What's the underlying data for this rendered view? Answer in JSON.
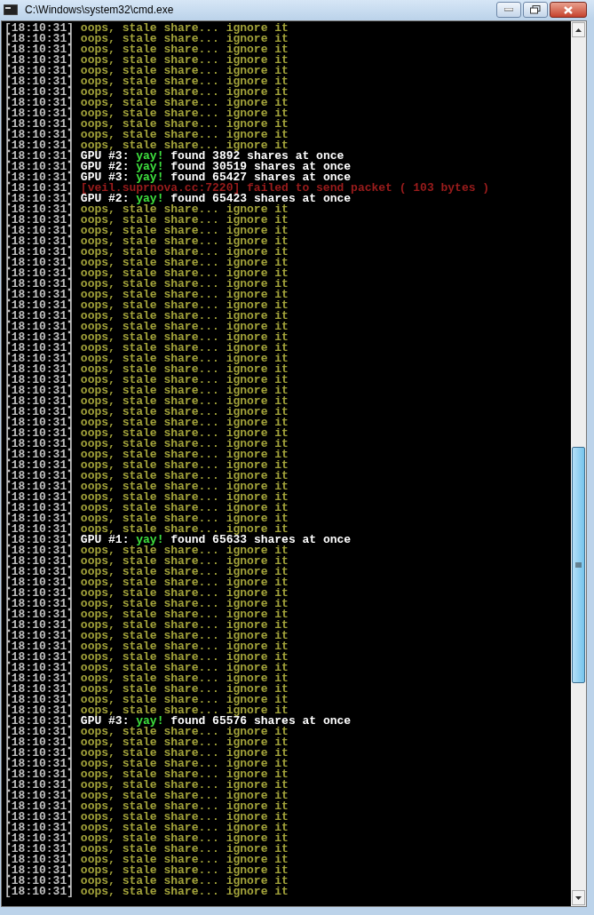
{
  "window": {
    "title": "C:\\Windows\\system32\\cmd.exe"
  },
  "lines": [
    {
      "kind": "stale",
      "time": "[18:10:31]",
      "text": "oops, stale share... ignore it"
    },
    {
      "kind": "stale",
      "time": "[18:10:31]",
      "text": "oops, stale share... ignore it"
    },
    {
      "kind": "stale",
      "time": "[18:10:31]",
      "text": "oops, stale share... ignore it"
    },
    {
      "kind": "stale",
      "time": "[18:10:31]",
      "text": "oops, stale share... ignore it"
    },
    {
      "kind": "stale",
      "time": "[18:10:31]",
      "text": "oops, stale share... ignore it"
    },
    {
      "kind": "stale",
      "time": "[18:10:31]",
      "text": "oops, stale share... ignore it"
    },
    {
      "kind": "stale",
      "time": "[18:10:31]",
      "text": "oops, stale share... ignore it"
    },
    {
      "kind": "stale",
      "time": "[18:10:31]",
      "text": "oops, stale share... ignore it"
    },
    {
      "kind": "stale",
      "time": "[18:10:31]",
      "text": "oops, stale share... ignore it"
    },
    {
      "kind": "stale",
      "time": "[18:10:31]",
      "text": "oops, stale share... ignore it"
    },
    {
      "kind": "stale",
      "time": "[18:10:31]",
      "text": "oops, stale share... ignore it"
    },
    {
      "kind": "stale",
      "time": "[18:10:31]",
      "text": "oops, stale share... ignore it"
    },
    {
      "kind": "found",
      "time": "[18:10:31]",
      "gpu": "GPU #3:",
      "yay": "yay!",
      "text": "found 3892 shares at once"
    },
    {
      "kind": "found",
      "time": "[18:10:31]",
      "gpu": "GPU #2:",
      "yay": "yay!",
      "text": "found 30519 shares at once"
    },
    {
      "kind": "found",
      "time": "[18:10:31]",
      "gpu": "GPU #3:",
      "yay": "yay!",
      "text": "found 65427 shares at once"
    },
    {
      "kind": "error",
      "time": "[18:10:31]",
      "text": "[veil.suprnova.cc:7220] failed to send packet ( 103 bytes )"
    },
    {
      "kind": "found",
      "time": "[18:10:31]",
      "gpu": "GPU #2:",
      "yay": "yay!",
      "text": "found 65423 shares at once"
    },
    {
      "kind": "stale",
      "time": "[18:10:31]",
      "text": "oops, stale share... ignore it"
    },
    {
      "kind": "stale",
      "time": "[18:10:31]",
      "text": "oops, stale share... ignore it"
    },
    {
      "kind": "stale",
      "time": "[18:10:31]",
      "text": "oops, stale share... ignore it"
    },
    {
      "kind": "stale",
      "time": "[18:10:31]",
      "text": "oops, stale share... ignore it"
    },
    {
      "kind": "stale",
      "time": "[18:10:31]",
      "text": "oops, stale share... ignore it"
    },
    {
      "kind": "stale",
      "time": "[18:10:31]",
      "text": "oops, stale share... ignore it"
    },
    {
      "kind": "stale",
      "time": "[18:10:31]",
      "text": "oops, stale share... ignore it"
    },
    {
      "kind": "stale",
      "time": "[18:10:31]",
      "text": "oops, stale share... ignore it"
    },
    {
      "kind": "stale",
      "time": "[18:10:31]",
      "text": "oops, stale share... ignore it"
    },
    {
      "kind": "stale",
      "time": "[18:10:31]",
      "text": "oops, stale share... ignore it"
    },
    {
      "kind": "stale",
      "time": "[18:10:31]",
      "text": "oops, stale share... ignore it"
    },
    {
      "kind": "stale",
      "time": "[18:10:31]",
      "text": "oops, stale share... ignore it"
    },
    {
      "kind": "stale",
      "time": "[18:10:31]",
      "text": "oops, stale share... ignore it"
    },
    {
      "kind": "stale",
      "time": "[18:10:31]",
      "text": "oops, stale share... ignore it"
    },
    {
      "kind": "stale",
      "time": "[18:10:31]",
      "text": "oops, stale share... ignore it"
    },
    {
      "kind": "stale",
      "time": "[18:10:31]",
      "text": "oops, stale share... ignore it"
    },
    {
      "kind": "stale",
      "time": "[18:10:31]",
      "text": "oops, stale share... ignore it"
    },
    {
      "kind": "stale",
      "time": "[18:10:31]",
      "text": "oops, stale share... ignore it"
    },
    {
      "kind": "stale",
      "time": "[18:10:31]",
      "text": "oops, stale share... ignore it"
    },
    {
      "kind": "stale",
      "time": "[18:10:31]",
      "text": "oops, stale share... ignore it"
    },
    {
      "kind": "stale",
      "time": "[18:10:31]",
      "text": "oops, stale share... ignore it"
    },
    {
      "kind": "stale",
      "time": "[18:10:31]",
      "text": "oops, stale share... ignore it"
    },
    {
      "kind": "stale",
      "time": "[18:10:31]",
      "text": "oops, stale share... ignore it"
    },
    {
      "kind": "stale",
      "time": "[18:10:31]",
      "text": "oops, stale share... ignore it"
    },
    {
      "kind": "stale",
      "time": "[18:10:31]",
      "text": "oops, stale share... ignore it"
    },
    {
      "kind": "stale",
      "time": "[18:10:31]",
      "text": "oops, stale share... ignore it"
    },
    {
      "kind": "stale",
      "time": "[18:10:31]",
      "text": "oops, stale share... ignore it"
    },
    {
      "kind": "stale",
      "time": "[18:10:31]",
      "text": "oops, stale share... ignore it"
    },
    {
      "kind": "stale",
      "time": "[18:10:31]",
      "text": "oops, stale share... ignore it"
    },
    {
      "kind": "stale",
      "time": "[18:10:31]",
      "text": "oops, stale share... ignore it"
    },
    {
      "kind": "stale",
      "time": "[18:10:31]",
      "text": "oops, stale share... ignore it"
    },
    {
      "kind": "found",
      "time": "[18:10:31]",
      "gpu": "GPU #1:",
      "yay": "yay!",
      "text": "found 65633 shares at once"
    },
    {
      "kind": "stale",
      "time": "[18:10:31]",
      "text": "oops, stale share... ignore it"
    },
    {
      "kind": "stale",
      "time": "[18:10:31]",
      "text": "oops, stale share... ignore it"
    },
    {
      "kind": "stale",
      "time": "[18:10:31]",
      "text": "oops, stale share... ignore it"
    },
    {
      "kind": "stale",
      "time": "[18:10:31]",
      "text": "oops, stale share... ignore it"
    },
    {
      "kind": "stale",
      "time": "[18:10:31]",
      "text": "oops, stale share... ignore it"
    },
    {
      "kind": "stale",
      "time": "[18:10:31]",
      "text": "oops, stale share... ignore it"
    },
    {
      "kind": "stale",
      "time": "[18:10:31]",
      "text": "oops, stale share... ignore it"
    },
    {
      "kind": "stale",
      "time": "[18:10:31]",
      "text": "oops, stale share... ignore it"
    },
    {
      "kind": "stale",
      "time": "[18:10:31]",
      "text": "oops, stale share... ignore it"
    },
    {
      "kind": "stale",
      "time": "[18:10:31]",
      "text": "oops, stale share... ignore it"
    },
    {
      "kind": "stale",
      "time": "[18:10:31]",
      "text": "oops, stale share... ignore it"
    },
    {
      "kind": "stale",
      "time": "[18:10:31]",
      "text": "oops, stale share... ignore it"
    },
    {
      "kind": "stale",
      "time": "[18:10:31]",
      "text": "oops, stale share... ignore it"
    },
    {
      "kind": "stale",
      "time": "[18:10:31]",
      "text": "oops, stale share... ignore it"
    },
    {
      "kind": "stale",
      "time": "[18:10:31]",
      "text": "oops, stale share... ignore it"
    },
    {
      "kind": "stale",
      "time": "[18:10:31]",
      "text": "oops, stale share... ignore it"
    },
    {
      "kind": "found",
      "time": "[18:10:31]",
      "gpu": "GPU #3:",
      "yay": "yay!",
      "text": "found 65576 shares at once"
    },
    {
      "kind": "stale",
      "time": "[18:10:31]",
      "text": "oops, stale share... ignore it"
    },
    {
      "kind": "stale",
      "time": "[18:10:31]",
      "text": "oops, stale share... ignore it"
    },
    {
      "kind": "stale",
      "time": "[18:10:31]",
      "text": "oops, stale share... ignore it"
    },
    {
      "kind": "stale",
      "time": "[18:10:31]",
      "text": "oops, stale share... ignore it"
    },
    {
      "kind": "stale",
      "time": "[18:10:31]",
      "text": "oops, stale share... ignore it"
    },
    {
      "kind": "stale",
      "time": "[18:10:31]",
      "text": "oops, stale share... ignore it"
    },
    {
      "kind": "stale",
      "time": "[18:10:31]",
      "text": "oops, stale share... ignore it"
    },
    {
      "kind": "stale",
      "time": "[18:10:31]",
      "text": "oops, stale share... ignore it"
    },
    {
      "kind": "stale",
      "time": "[18:10:31]",
      "text": "oops, stale share... ignore it"
    },
    {
      "kind": "stale",
      "time": "[18:10:31]",
      "text": "oops, stale share... ignore it"
    },
    {
      "kind": "stale",
      "time": "[18:10:31]",
      "text": "oops, stale share... ignore it"
    },
    {
      "kind": "stale",
      "time": "[18:10:31]",
      "text": "oops, stale share... ignore it"
    },
    {
      "kind": "stale",
      "time": "[18:10:31]",
      "text": "oops, stale share... ignore it"
    },
    {
      "kind": "stale",
      "time": "[18:10:31]",
      "text": "oops, stale share... ignore it"
    },
    {
      "kind": "stale",
      "time": "[18:10:31]",
      "text": "oops, stale share... ignore it"
    },
    {
      "kind": "stale",
      "time": "[18:10:31]",
      "text": "oops, stale share... ignore it"
    }
  ]
}
